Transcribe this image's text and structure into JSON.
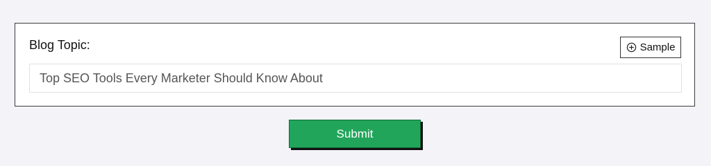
{
  "form": {
    "topic_label": "Blog Topic:",
    "sample_label": "Sample",
    "sample_icon": "plus-circle-icon",
    "topic_value": "Top SEO Tools Every Marketer Should Know About",
    "submit_label": "Submit"
  },
  "colors": {
    "page_background": "#f4f4f8",
    "submit_background": "#21a55a",
    "submit_text": "#ffffff"
  }
}
